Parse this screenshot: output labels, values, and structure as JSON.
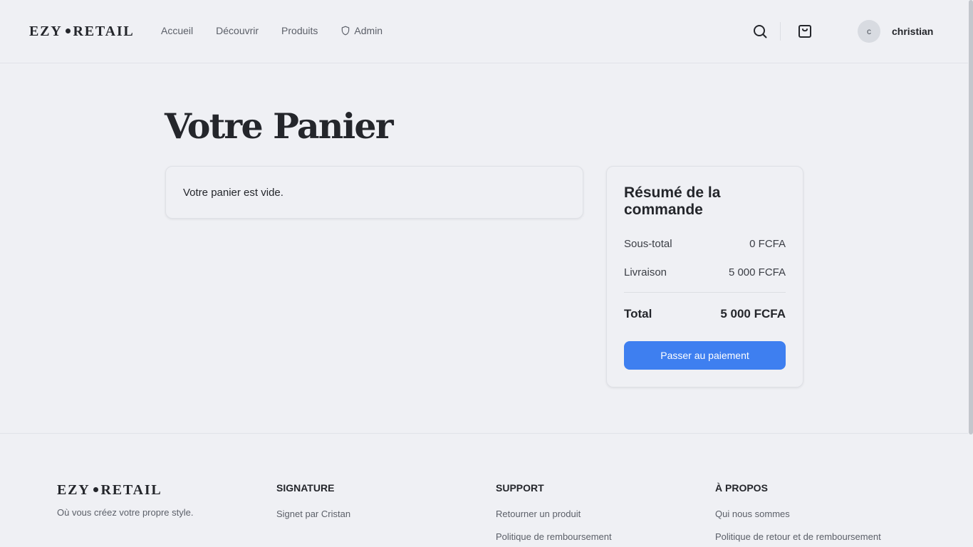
{
  "header": {
    "logo_left": "EZY",
    "logo_right": "RETAIL",
    "nav": [
      {
        "label": "Accueil"
      },
      {
        "label": "Découvrir"
      },
      {
        "label": "Produits"
      },
      {
        "label": "Admin",
        "icon": "shield-icon"
      }
    ],
    "avatar_initial": "c",
    "username": "christian"
  },
  "main": {
    "title": "Votre Panier",
    "cart_empty": "Votre panier est vide."
  },
  "summary": {
    "title": "Résumé de la commande",
    "subtotal_label": "Sous-total",
    "subtotal_value": "0 FCFA",
    "shipping_label": "Livraison",
    "shipping_value": "5 000 FCFA",
    "total_label": "Total",
    "total_value": "5 000 FCFA",
    "pay_button": "Passer au paiement"
  },
  "footer": {
    "logo_left": "EZY",
    "logo_right": "RETAIL",
    "tagline": "Où vous créez votre propre style.",
    "columns": [
      {
        "title": "SIGNATURE",
        "links": [
          "Signet par Cristan"
        ]
      },
      {
        "title": "SUPPORT",
        "links": [
          "Retourner un produit",
          "Politique de remboursement"
        ]
      },
      {
        "title": "À PROPOS",
        "links": [
          "Qui nous sommes",
          "Politique de retour et de remboursement"
        ]
      }
    ]
  },
  "colors": {
    "background": "#eff0f4",
    "text": "#24262b",
    "primary_button": "#3e7ff0"
  }
}
